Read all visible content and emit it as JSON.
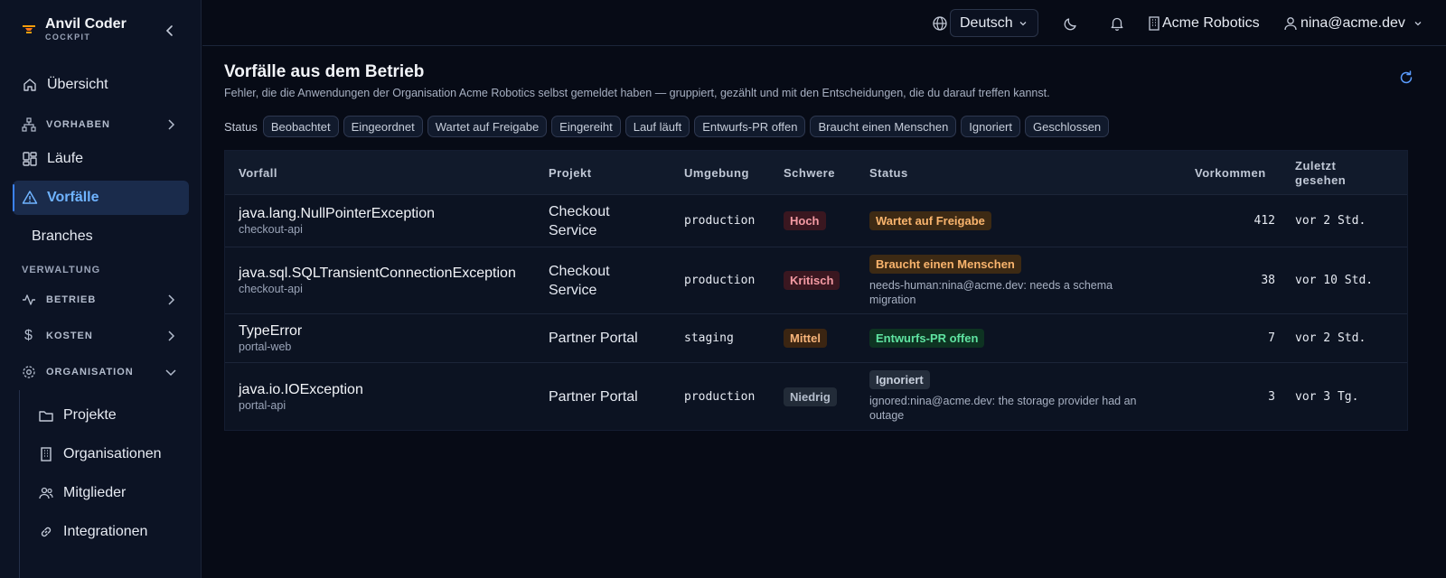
{
  "app": {
    "name": "Anvil Coder",
    "sub": "COCKPIT"
  },
  "sidebar": {
    "overview": "Übersicht",
    "vorhaben": "VORHABEN",
    "laeufe": "Läufe",
    "vorfaelle": "Vorfälle",
    "branches": "Branches",
    "section_verwaltung": "VERWALTUNG",
    "betrieb": "BETRIEB",
    "kosten": "KOSTEN",
    "organisation": "ORGANISATION",
    "org_items": [
      "Projekte",
      "Organisationen",
      "Mitglieder",
      "Integrationen"
    ]
  },
  "topbar": {
    "language": "Deutsch",
    "org": "Acme Robotics",
    "user": "nina@acme.dev"
  },
  "page": {
    "title": "Vorfälle aus dem Betrieb",
    "subtitle": "Fehler, die die Anwendungen der Organisation Acme Robotics selbst gemeldet haben — gruppiert, gezählt und mit den Entscheidungen, die du darauf treffen kannst."
  },
  "filters": {
    "label": "Status",
    "chips": [
      "Beobachtet",
      "Eingeordnet",
      "Wartet auf Freigabe",
      "Eingereiht",
      "Lauf läuft",
      "Entwurfs-PR offen",
      "Braucht einen Menschen",
      "Ignoriert",
      "Geschlossen"
    ]
  },
  "table": {
    "headers": {
      "vorfall": "Vorfall",
      "projekt": "Projekt",
      "umgebung": "Umgebung",
      "schwere": "Schwere",
      "status": "Status",
      "vorkommen": "Vorkommen",
      "zuletzt_1": "Zuletzt",
      "zuletzt_2": "gesehen"
    },
    "rows": [
      {
        "name": "java.lang.NullPointerException",
        "service": "checkout-api",
        "project_1": "Checkout",
        "project_2": "Service",
        "env": "production",
        "severity": "Hoch",
        "status": "Wartet auf Freigabe",
        "note_1": "",
        "note_2": "",
        "count": "412",
        "last_seen": "vor 2 Std."
      },
      {
        "name": "java.sql.SQLTransientConnectionException",
        "service": "checkout-api",
        "project_1": "Checkout",
        "project_2": "Service",
        "env": "production",
        "severity": "Kritisch",
        "status": "Braucht einen Menschen",
        "note_1": "needs-human:nina@acme.dev: needs a schema",
        "note_2": "migration",
        "count": "38",
        "last_seen": "vor 10 Std."
      },
      {
        "name": "TypeError",
        "service": "portal-web",
        "project_1": "Partner Portal",
        "project_2": "",
        "env": "staging",
        "severity": "Mittel",
        "status": "Entwurfs-PR offen",
        "note_1": "",
        "note_2": "",
        "count": "7",
        "last_seen": "vor 2 Std."
      },
      {
        "name": "java.io.IOException",
        "service": "portal-api",
        "project_1": "Partner Portal",
        "project_2": "",
        "env": "production",
        "severity": "Niedrig",
        "status": "Ignoriert",
        "note_1": "ignored:nina@acme.dev: the storage provider had an",
        "note_2": "outage",
        "count": "3",
        "last_seen": "vor 3 Tg."
      }
    ]
  },
  "colors": {
    "accent": "#3b82f6",
    "active_nav_bg": "#1a2b4b",
    "sev_high": "#f49aa3",
    "sev_medium": "#f7b47a",
    "status_waiting": "#f9b46d",
    "status_pr": "#5fe3a1"
  },
  "icons": {
    "overview": "home-icon",
    "vorhaben": "hierarchy-icon",
    "laeufe": "grid-icon",
    "vorfaelle": "warning-icon",
    "betrieb": "activity-icon",
    "kosten": "dollar-icon",
    "organisation": "gear-icon",
    "projekte": "folder-icon",
    "organisationen": "building-icon",
    "mitglieder": "users-icon",
    "integrationen": "link-icon",
    "language": "globe-icon",
    "theme": "moon-icon",
    "notifications": "bell-icon",
    "org": "building-icon",
    "user": "user-icon",
    "refresh": "refresh-icon"
  }
}
